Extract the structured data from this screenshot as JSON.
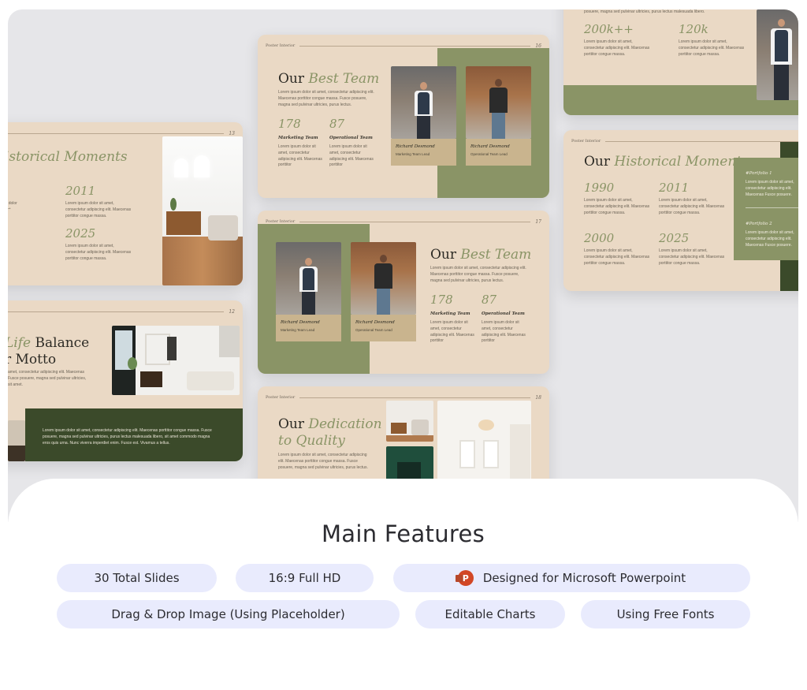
{
  "slides": {
    "brand": "Poster Interior",
    "s13": {
      "num": "13",
      "title_plain": "",
      "title_accent": "istorical Moments",
      "stats": [
        {
          "value": "2011",
          "text": "Lorem ipsum dolor sit amet, consectetur adipiscing elit. Maecenas porttitor congue massa."
        },
        {
          "value": "2025",
          "text": "Lorem ipsum dolor sit amet, consectetur adipiscing elit. Maecenas porttitor congue massa."
        }
      ],
      "cut_text": "Lorem ipsum dolor sit amet, consectetur adipiscing elit. Maecenas"
    },
    "s16": {
      "num": "16",
      "title_plain": "Our",
      "title_accent": "Best Team",
      "para": "Lorem ipsum dolor sit amet, consectetur adipiscing elit. Maecenas porttitor congue massa. Fusce posuere, magna sed pulvinar ultricies, purus lectus.",
      "stats": [
        {
          "value": "178",
          "label": "Marketing Team",
          "text": "Lorem ipsum dolor sit amet, consectetur adipiscing elit. Maecenas porttitor"
        },
        {
          "value": "87",
          "label": "Operational Team",
          "text": "Lorem ipsum dolor sit amet, consectetur adipiscing elit. Maecenas porttitor"
        }
      ],
      "cards": [
        {
          "name": "Richard Desmond",
          "role": "Marketing Team Lead"
        },
        {
          "name": "Richard Desmond",
          "role": "Operational Team Lead"
        }
      ]
    },
    "s17": {
      "num": "17",
      "title_plain": "Our",
      "title_accent": "Best Team",
      "para": "Lorem ipsum dolor sit amet, consectetur adipiscing elit. Maecenas porttitor congue massa. Fusce posuere, magna sed pulvinar ultricies, purus lectus.",
      "stats": [
        {
          "value": "178",
          "label": "Marketing Team",
          "text": "Lorem ipsum dolor sit amet, consectetur adipiscing elit. Maecenas porttitor"
        },
        {
          "value": "87",
          "label": "Operational Team",
          "text": "Lorem ipsum dolor sit amet, consectetur adipiscing elit. Maecenas porttitor"
        }
      ],
      "cards": [
        {
          "name": "Richard Desmond",
          "role": "Marketing Team Lead"
        },
        {
          "name": "Richard Desmond",
          "role": "Operational Team Lead"
        }
      ]
    },
    "s12": {
      "num": "12",
      "title_accent": "Life",
      "title_plain": "Balance",
      "title_line2": "r Motto",
      "para": "amet, consectetur adipiscing elit. Maecenas Fusce posuere, magna sed pulvinar ultricies, sit amet.",
      "bottom_text": "Lorem ipsum dolor sit amet, consectetur adipiscing elit. Maecenas porttitor congue massa. Fusce posuere, magna sed pulvinar ultricies, purus lectus malesuada libero, sit amet commodo magna eros quis urna. Nunc viverra imperdiet enim. Fusce est. Vivamus a tellus."
    },
    "s18": {
      "num": "18",
      "title_plain": "Our",
      "title_accent": "Dedication",
      "title_line2": "to Quality",
      "para": "Lorem ipsum dolor sit amet, consectetur adipiscing elit. Maecenas porttitor congue massa. Fusce posuere, magna sed pulvinar ultricies, purus lectus."
    },
    "sTopRight": {
      "top_text": "posuere, magna sed pulvinar ultricies, purus lectus malesuada libero.",
      "stats": [
        {
          "value": "200k++",
          "text": "Lorem ipsum dolor sit amet, consectetur adipiscing elit. Maecenas porttitor congue massa."
        },
        {
          "value": "120k",
          "text": "Lorem ipsum dolor sit amet, consectetur adipiscing elit. Maecenas porttitor congue massa."
        }
      ]
    },
    "sHist": {
      "title_plain": "Our",
      "title_accent": "Historical Moments",
      "stats": [
        {
          "value": "1990",
          "text": "Lorem ipsum dolor sit amet, consectetur adipiscing elit. Maecenas porttitor congue massa."
        },
        {
          "value": "2011",
          "text": "Lorem ipsum dolor sit amet, consectetur adipiscing elit. Maecenas porttitor congue massa."
        },
        {
          "value": "2000",
          "text": "Lorem ipsum dolor sit amet, consectetur adipiscing elit. Maecenas porttitor congue massa."
        },
        {
          "value": "2025",
          "text": "Lorem ipsum dolor sit amet, consectetur adipiscing elit. Maecenas porttitor congue massa."
        }
      ],
      "portfolio": [
        {
          "label": "#Portfolio 1",
          "text": "Lorem ipsum dolor sit amet, consectetur adipiscing elit. Maecenas Fusce posuere."
        },
        {
          "label": "#Portfolio 2",
          "text": "Lorem ipsum dolor sit amet, consectetur adipiscing elit. Maecenas Fusce posuere."
        }
      ]
    }
  },
  "features": {
    "title": "Main Features",
    "items": [
      "30 Total Slides",
      "16:9 Full HD",
      "Designed for Microsoft Powerpoint",
      "Drag & Drop Image (Using Placeholder)",
      "Editable Charts",
      "Using Free Fonts"
    ],
    "ppt_icon_letter": "P"
  },
  "colors": {
    "slide_bg": "#ead9c5",
    "olive": "#8a9466",
    "dark_green": "#3b4a2a",
    "pill_bg": "#e9ebfd",
    "canvas_bg": "#e6e6e9"
  }
}
